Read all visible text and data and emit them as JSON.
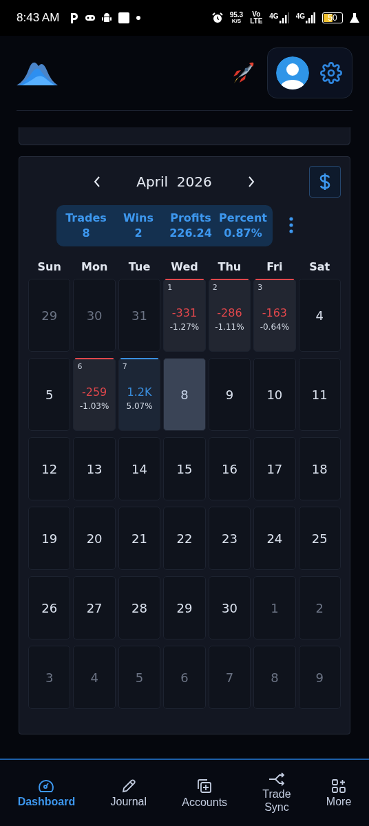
{
  "status_bar": {
    "time": "8:43 AM",
    "speed": "95.3",
    "speed_unit": "K/S",
    "volte_top": "Vo",
    "volte_bottom": "LTE",
    "network_1": "4G",
    "network_2": "4G",
    "battery": "50"
  },
  "calendar": {
    "month": "April  2026",
    "stats": [
      {
        "label": "Trades",
        "value": "8"
      },
      {
        "label": "Wins",
        "value": "2"
      },
      {
        "label": "Profits",
        "value": "226.24"
      },
      {
        "label": "Percent",
        "value": "0.87%"
      }
    ],
    "weekdays": [
      "Sun",
      "Mon",
      "Tue",
      "Wed",
      "Thu",
      "Fri",
      "Sat"
    ],
    "days": [
      {
        "kind": "outside",
        "day": "29"
      },
      {
        "kind": "outside",
        "day": "30"
      },
      {
        "kind": "outside",
        "day": "31"
      },
      {
        "kind": "trade",
        "day": "1",
        "amount": "-331",
        "percent": "-1.27%",
        "color": "#e0474c"
      },
      {
        "kind": "trade",
        "day": "2",
        "amount": "-286",
        "percent": "-1.11%",
        "color": "#e0474c"
      },
      {
        "kind": "trade",
        "day": "3",
        "amount": "-163",
        "percent": "-0.64%",
        "color": "#e0474c"
      },
      {
        "kind": "day",
        "day": "4"
      },
      {
        "kind": "day",
        "day": "5"
      },
      {
        "kind": "trade",
        "day": "6",
        "amount": "-259",
        "percent": "-1.03%",
        "color": "#e0474c"
      },
      {
        "kind": "trade",
        "day": "7",
        "amount": "1.2K",
        "percent": "5.07%",
        "color": "#3a8fe0"
      },
      {
        "kind": "today",
        "day": "8"
      },
      {
        "kind": "day",
        "day": "9"
      },
      {
        "kind": "day",
        "day": "10"
      },
      {
        "kind": "day",
        "day": "11"
      },
      {
        "kind": "day",
        "day": "12"
      },
      {
        "kind": "day",
        "day": "13"
      },
      {
        "kind": "day",
        "day": "14"
      },
      {
        "kind": "day",
        "day": "15"
      },
      {
        "kind": "day",
        "day": "16"
      },
      {
        "kind": "day",
        "day": "17"
      },
      {
        "kind": "day",
        "day": "18"
      },
      {
        "kind": "day",
        "day": "19"
      },
      {
        "kind": "day",
        "day": "20"
      },
      {
        "kind": "day",
        "day": "21"
      },
      {
        "kind": "day",
        "day": "22"
      },
      {
        "kind": "day",
        "day": "23"
      },
      {
        "kind": "day",
        "day": "24"
      },
      {
        "kind": "day",
        "day": "25"
      },
      {
        "kind": "day",
        "day": "26"
      },
      {
        "kind": "day",
        "day": "27"
      },
      {
        "kind": "day",
        "day": "28"
      },
      {
        "kind": "day",
        "day": "29"
      },
      {
        "kind": "day",
        "day": "30"
      },
      {
        "kind": "outside",
        "day": "1"
      },
      {
        "kind": "outside",
        "day": "2"
      },
      {
        "kind": "outside",
        "day": "3"
      },
      {
        "kind": "outside",
        "day": "4"
      },
      {
        "kind": "outside",
        "day": "5"
      },
      {
        "kind": "outside",
        "day": "6"
      },
      {
        "kind": "outside",
        "day": "7"
      },
      {
        "kind": "outside",
        "day": "8"
      },
      {
        "kind": "outside",
        "day": "9"
      }
    ]
  },
  "bottom_nav": [
    {
      "label": "Dashboard",
      "selected": true
    },
    {
      "label": "Journal",
      "selected": false
    },
    {
      "label": "Accounts",
      "selected": false
    },
    {
      "label": "Trade\nSync",
      "selected": false
    },
    {
      "label": "More",
      "selected": false
    }
  ]
}
